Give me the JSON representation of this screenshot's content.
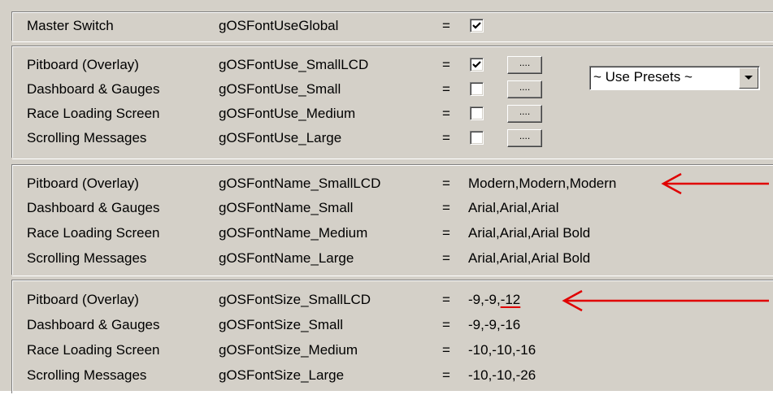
{
  "master": {
    "label": "Master Switch",
    "key": "gOSFontUseGlobal",
    "eq": "=",
    "checked": true
  },
  "use_rows": [
    {
      "label": "Pitboard (Overlay)",
      "key": "gOSFontUse_SmallLCD",
      "eq": "=",
      "checked": true,
      "button": "...."
    },
    {
      "label": "Dashboard & Gauges",
      "key": "gOSFontUse_Small",
      "eq": "=",
      "checked": false,
      "button": "...."
    },
    {
      "label": "Race Loading Screen",
      "key": "gOSFontUse_Medium",
      "eq": "=",
      "checked": false,
      "button": "...."
    },
    {
      "label": "Scrolling Messages",
      "key": "gOSFontUse_Large",
      "eq": "=",
      "checked": false,
      "button": "...."
    }
  ],
  "presets": {
    "selected": "~ Use Presets ~"
  },
  "name_rows": [
    {
      "label": "Pitboard (Overlay)",
      "key": "gOSFontName_SmallLCD",
      "eq": "=",
      "value": "Modern,Modern,Modern"
    },
    {
      "label": "Dashboard & Gauges",
      "key": "gOSFontName_Small",
      "eq": "=",
      "value": "Arial,Arial,Arial"
    },
    {
      "label": "Race Loading Screen",
      "key": "gOSFontName_Medium",
      "eq": "=",
      "value": "Arial,Arial,Arial Bold"
    },
    {
      "label": "Scrolling Messages",
      "key": "gOSFontName_Large",
      "eq": "=",
      "value": "Arial,Arial,Arial Bold"
    }
  ],
  "size_rows": [
    {
      "label": "Pitboard (Overlay)",
      "key": "gOSFontSize_SmallLCD",
      "eq": "=",
      "value_prefix": "-9,-9,",
      "value_underlined": "-12"
    },
    {
      "label": "Dashboard & Gauges",
      "key": "gOSFontSize_Small",
      "eq": "=",
      "value": "-9,-9,-16"
    },
    {
      "label": "Race Loading Screen",
      "key": "gOSFontSize_Medium",
      "eq": "=",
      "value": "-10,-10,-16"
    },
    {
      "label": "Scrolling Messages",
      "key": "gOSFontSize_Large",
      "eq": "=",
      "value": "-10,-10,-26"
    }
  ],
  "colors": {
    "annotation": "#e00000",
    "panel": "#d4d0c8"
  }
}
